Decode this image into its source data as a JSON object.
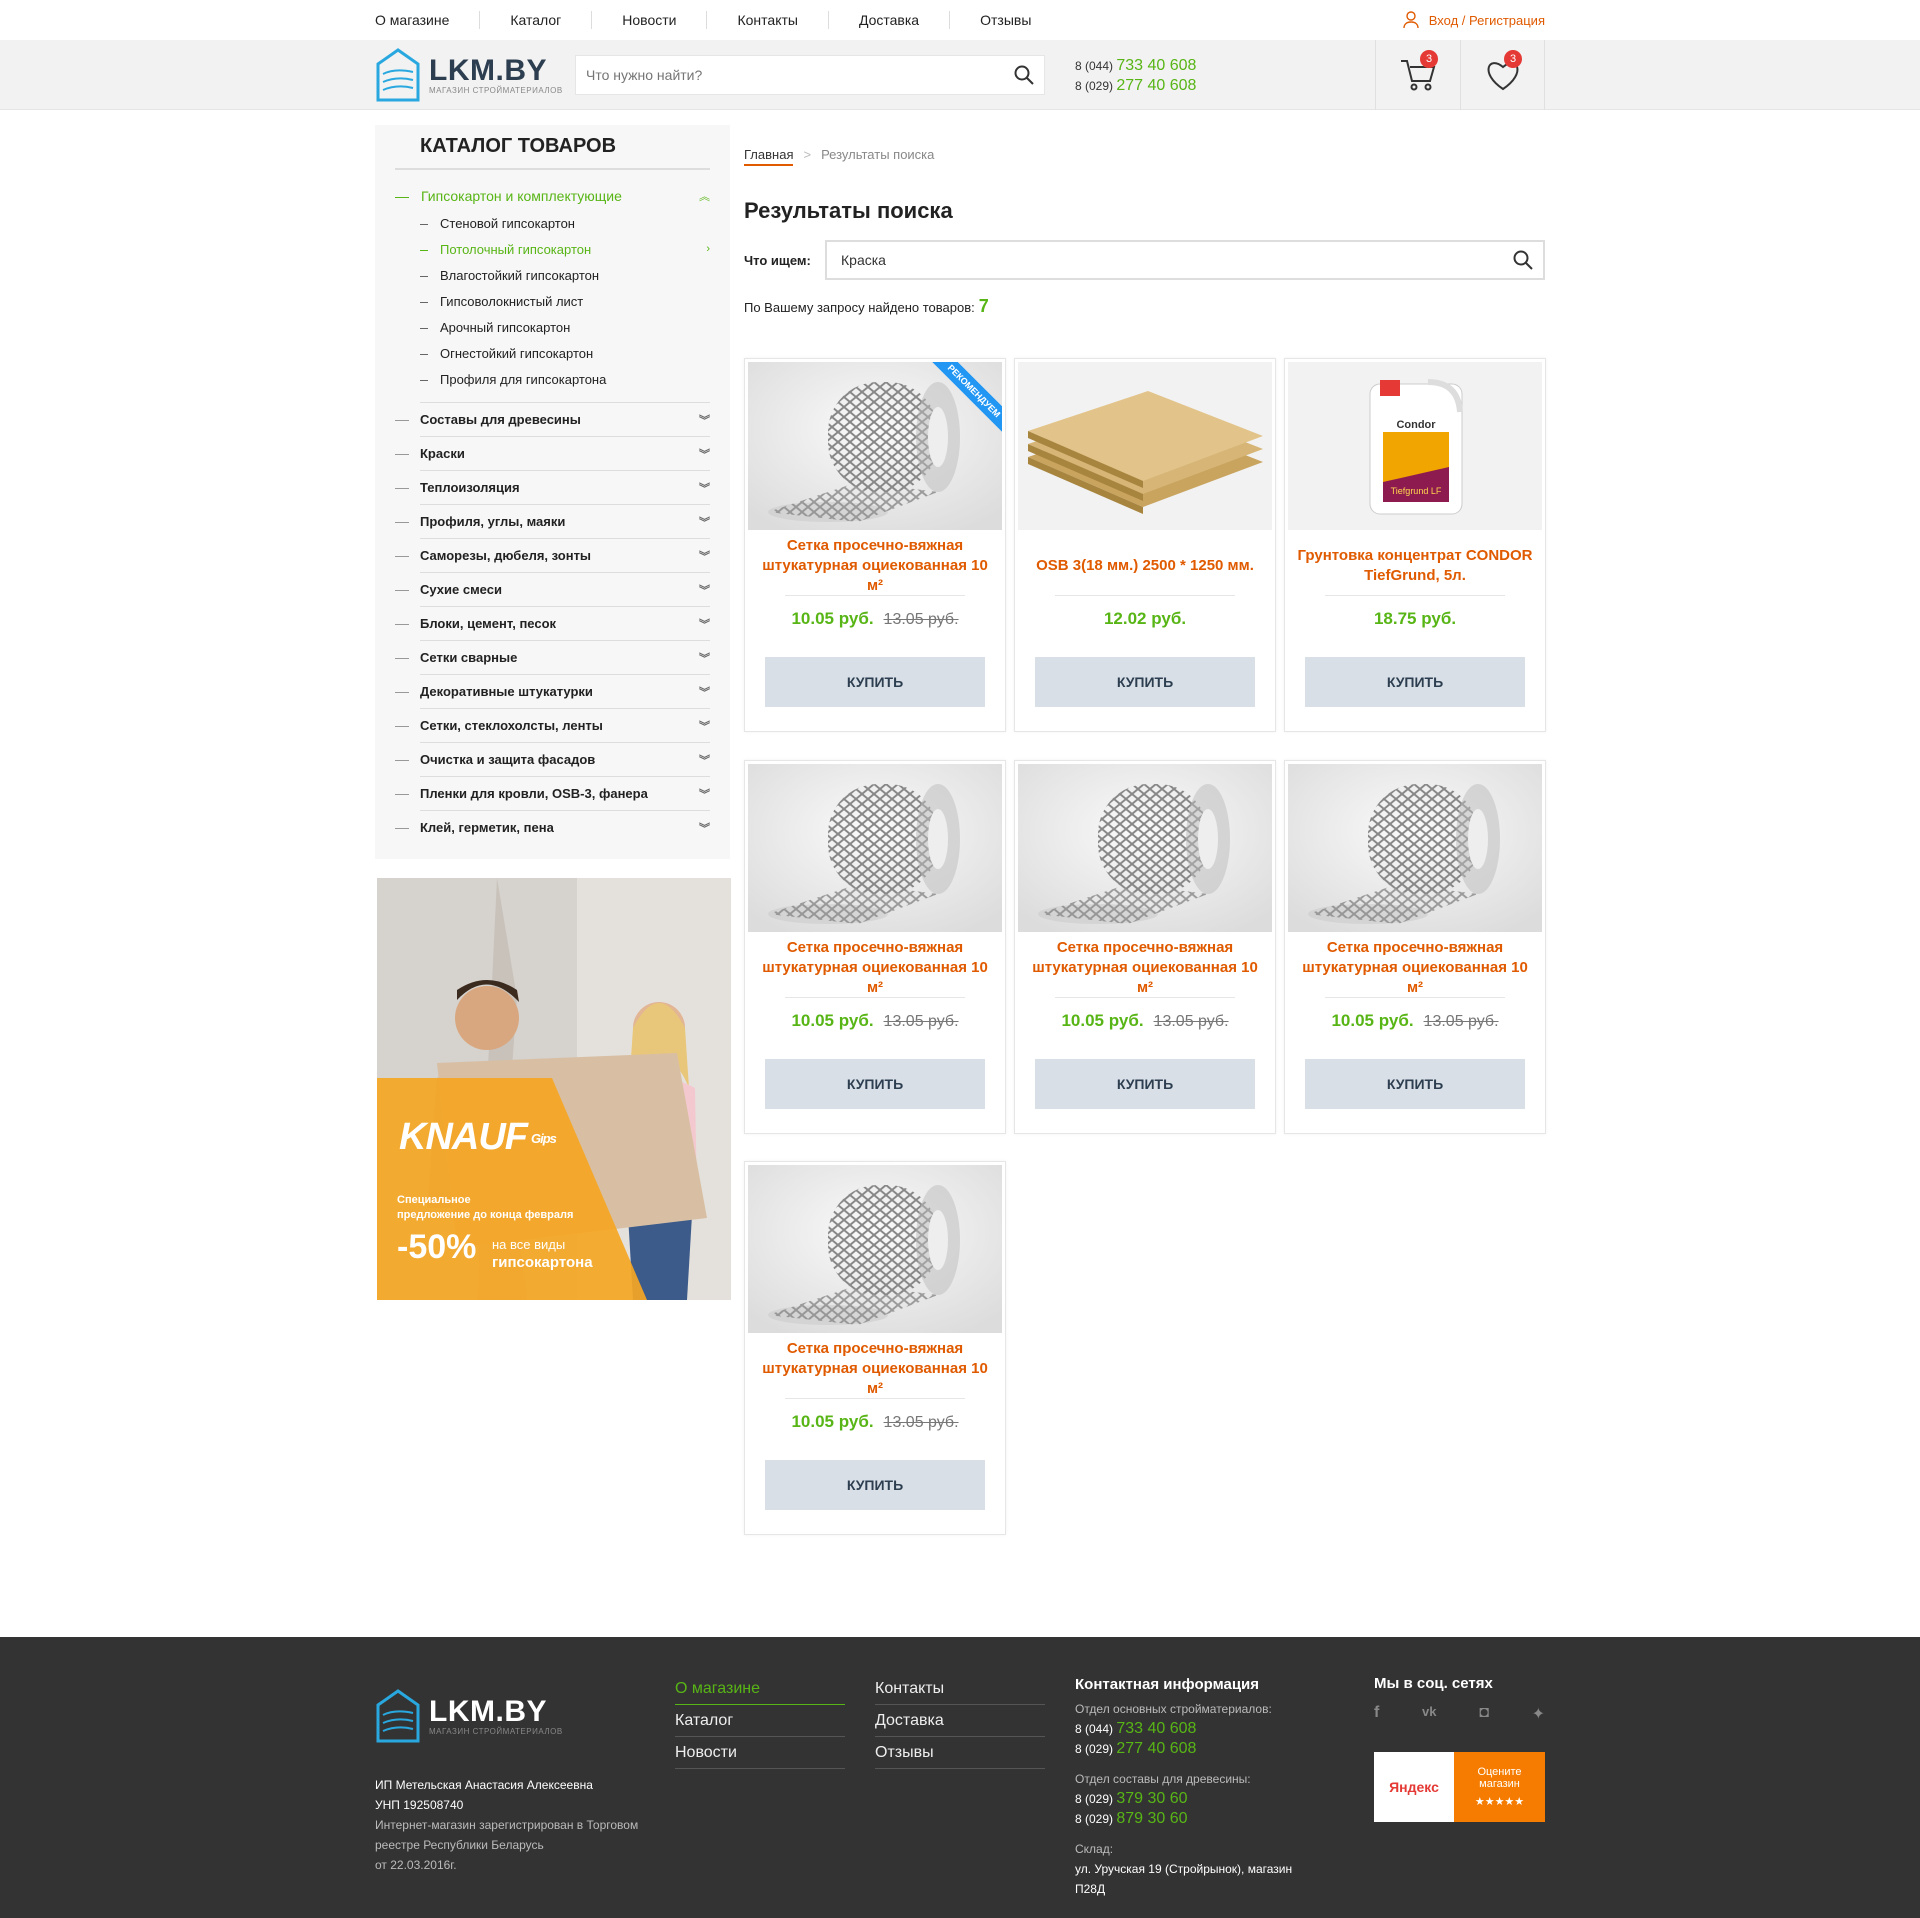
{
  "topnav": {
    "links": [
      "О магазине",
      "Каталог",
      "Новости",
      "Контакты",
      "Доставка",
      "Отзывы"
    ],
    "login": "Вход / Регистрация"
  },
  "header": {
    "logo": "LKM.BY",
    "logo_sub": "МАГАЗИН СТРОЙМАТЕРИАЛОВ",
    "search_placeholder": "Что нужно найти?",
    "phone1_code": "8 (044)",
    "phone1": "733 40 608",
    "phone2_code": "8 (029)",
    "phone2": "277 40 608",
    "cart_count": "3",
    "wishlist_count": "3"
  },
  "sidebar": {
    "title": "КАТАЛОГ ТОВАРОВ",
    "open_category": "Гипсокартон и комплектующие",
    "subs": [
      "Стеновой гипсокартон",
      "Потолочный гипсокартон",
      "Влагостойкий гипсокартон",
      "Гипсоволокнистый лист",
      "Арочный гипсокартон",
      "Огнестойкий гипсокартон",
      "Профиля для гипсокартона"
    ],
    "categories": [
      "Составы для древесины",
      "Краски",
      "Теплоизоляция",
      "Профиля, углы, маяки",
      "Саморезы, дюбеля, зонты",
      "Сухие смеси",
      "Блоки, цемент, песок",
      "Сетки сварные",
      "Декоративные штукатурки",
      "Сетки, стеклохолсты, ленты",
      "Очистка и защита фасадов",
      "Пленки для кровли, OSB-3, фанера",
      "Клей, герметик, пена"
    ]
  },
  "banner": {
    "brand": "KNAUF",
    "brand_sub": "Gips",
    "offer_line1": "Специальное",
    "offer_line2": "предложение до конца февраля",
    "discount": "-50%",
    "target_line1": "на все виды",
    "target_line2": "гипсокартона"
  },
  "main": {
    "breadcrumb_home": "Главная",
    "breadcrumb_sep": ">",
    "breadcrumb_current": "Результаты поиска",
    "title": "Результаты поиска",
    "query_label": "Что ищем:",
    "query_value": "Краска",
    "found_label": "По Вашему запросу найдено товаров:",
    "found_count": "7"
  },
  "products": [
    {
      "name": "Сетка просечно-вяжная штукатурная оциекованная 10 м²",
      "price": "10.05 руб.",
      "old_price": "13.05 руб.",
      "buy": "КУПИТЬ",
      "ribbon": "РЕКОМЕНДУЕМ",
      "image": "mesh-roll"
    },
    {
      "name": "OSB 3(18 мм.) 2500 * 1250 мм.",
      "price": "12.02 руб.",
      "old_price": "",
      "buy": "КУПИТЬ",
      "ribbon": "",
      "image": "osb-boards"
    },
    {
      "name": "Грунтовка концентрат CONDOR TiefGrund, 5л.",
      "price": "18.75 руб.",
      "old_price": "",
      "buy": "КУПИТЬ",
      "ribbon": "",
      "image": "primer-canister"
    },
    {
      "name": "Сетка просечно-вяжная штукатурная оциекованная 10 м²",
      "price": "10.05 руб.",
      "old_price": "13.05 руб.",
      "buy": "КУПИТЬ",
      "ribbon": "",
      "image": "mesh-roll"
    },
    {
      "name": "Сетка просечно-вяжная штукатурная оциекованная 10 м²",
      "price": "10.05 руб.",
      "old_price": "13.05 руб.",
      "buy": "КУПИТЬ",
      "ribbon": "",
      "image": "mesh-roll"
    },
    {
      "name": "Сетка просечно-вяжная штукатурная оциекованная 10 м²",
      "price": "10.05 руб.",
      "old_price": "13.05 руб.",
      "buy": "КУПИТЬ",
      "ribbon": "",
      "image": "mesh-roll"
    },
    {
      "name": "Сетка просечно-вяжная штукатурная оциекованная 10 м²",
      "price": "10.05 руб.",
      "old_price": "13.05 руб.",
      "buy": "КУПИТЬ",
      "ribbon": "",
      "image": "mesh-roll"
    }
  ],
  "footer": {
    "logo": "LKM.BY",
    "logo_sub": "МАГАЗИН СТРОЙМАТЕРИАЛОВ",
    "legal1": "ИП Метельская Анастасия Алексеевна",
    "legal2": "УНП 192508740",
    "legal3": "Интернет-магазин зарегистрирован в Торговом реестре Республики Беларусь",
    "legal4": "от 22.03.2016г.",
    "menu_col1": [
      "О магазине",
      "Каталог",
      "Новости"
    ],
    "menu_col2": [
      "Контакты",
      "Доставка",
      "Отзывы"
    ],
    "contact_title": "Контактная информация",
    "dept1": "Отдел основных стройматериалов:",
    "dept1_phone1_code": "8 (044)",
    "dept1_phone1": "733 40 608",
    "dept1_phone2_code": "8 (029)",
    "dept1_phone2": "277 40 608",
    "dept2": "Отдел составы для древесины:",
    "dept2_phone1_code": "8 (029)",
    "dept2_phone1": "379 30 60",
    "dept2_phone2_code": "8 (029)",
    "dept2_phone2": "879 30 60",
    "warehouse_label": "Склад:",
    "warehouse_addr": "ул. Уручская 19 (Стройрынок), магазин П28Д",
    "social_title": "Мы в соц. сетях",
    "yandex": "Яндекс",
    "yandex_rate1": "Оцените",
    "yandex_rate2": "магазин",
    "yandex_stars": "★★★★★"
  },
  "colors": {
    "accent_green": "#58b516",
    "accent_orange": "#e05a00",
    "footer_bg": "#333333",
    "button_bg": "#d8dfe7"
  }
}
